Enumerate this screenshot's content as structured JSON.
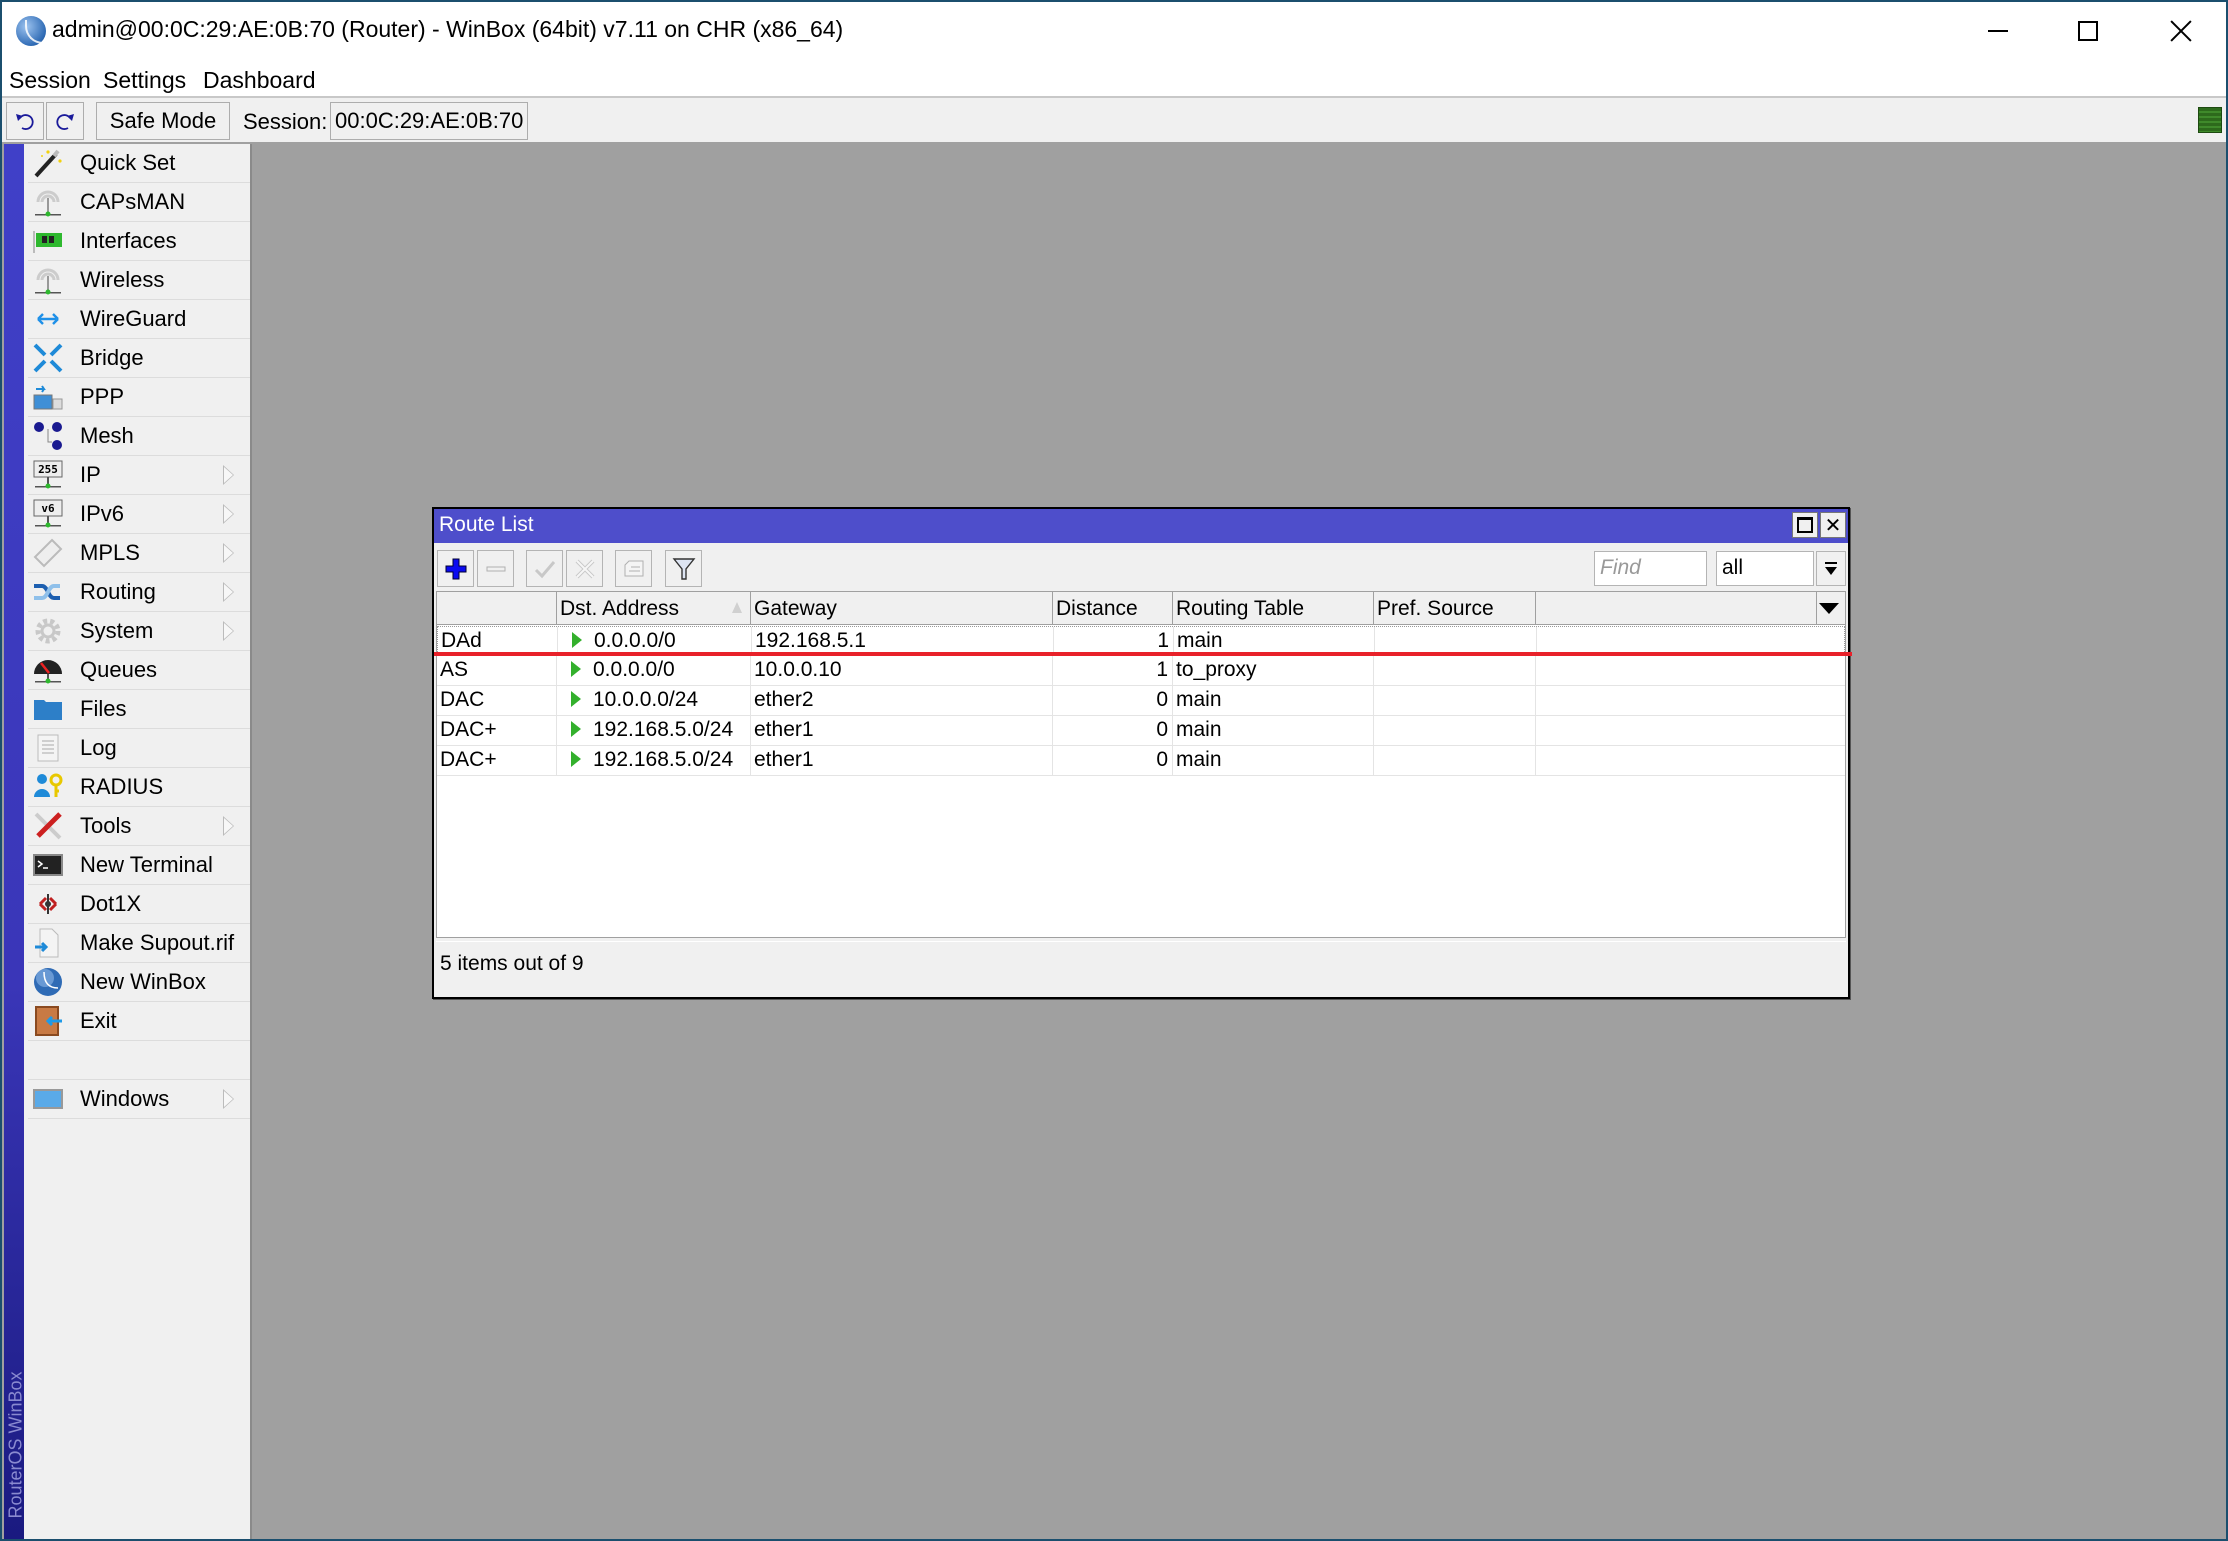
{
  "window": {
    "title": "admin@00:0C:29:AE:0B:70 (Router) - WinBox (64bit) v7.11 on CHR (x86_64)",
    "controls": {
      "minimize": "minimize",
      "maximize": "maximize",
      "close": "close"
    }
  },
  "menubar": [
    "Session",
    "Settings",
    "Dashboard"
  ],
  "toolbar": {
    "undo_icon": "undo-icon",
    "redo_icon": "redo-icon",
    "safe_mode_label": "Safe Mode",
    "session_label": "Session:",
    "session_value": "00:0C:29:AE:0B:70",
    "status_color": "#2d6a1c"
  },
  "sidebar": {
    "brand_vertical": "RouterOS WinBox",
    "accent_color": "#3a36b8",
    "items": [
      {
        "label": "Quick Set",
        "icon": "magic-wand-icon",
        "submenu": false
      },
      {
        "label": "CAPsMAN",
        "icon": "antenna-icon",
        "submenu": false
      },
      {
        "label": "Interfaces",
        "icon": "network-card-icon",
        "submenu": false
      },
      {
        "label": "Wireless",
        "icon": "antenna-icon",
        "submenu": false
      },
      {
        "label": "WireGuard",
        "icon": "wireguard-icon",
        "submenu": false
      },
      {
        "label": "Bridge",
        "icon": "bridge-arrows-icon",
        "submenu": false
      },
      {
        "label": "PPP",
        "icon": "ppp-icon",
        "submenu": false
      },
      {
        "label": "Mesh",
        "icon": "mesh-icon",
        "submenu": false
      },
      {
        "label": "IP",
        "icon": "ip-255-icon",
        "submenu": true
      },
      {
        "label": "IPv6",
        "icon": "ipv6-icon",
        "submenu": true
      },
      {
        "label": "MPLS",
        "icon": "tag-icon",
        "submenu": true
      },
      {
        "label": "Routing",
        "icon": "routing-arrows-icon",
        "submenu": true
      },
      {
        "label": "System",
        "icon": "gear-icon",
        "submenu": true
      },
      {
        "label": "Queues",
        "icon": "gauge-icon",
        "submenu": false
      },
      {
        "label": "Files",
        "icon": "folder-icon",
        "submenu": false
      },
      {
        "label": "Log",
        "icon": "log-icon",
        "submenu": false
      },
      {
        "label": "RADIUS",
        "icon": "user-key-icon",
        "submenu": false
      },
      {
        "label": "Tools",
        "icon": "tools-icon",
        "submenu": true
      },
      {
        "label": "New Terminal",
        "icon": "terminal-icon",
        "submenu": false
      },
      {
        "label": "Dot1X",
        "icon": "dot1x-icon",
        "submenu": false
      },
      {
        "label": "Make Supout.rif",
        "icon": "file-export-icon",
        "submenu": false
      },
      {
        "label": "New WinBox",
        "icon": "winbox-logo-icon",
        "submenu": false
      },
      {
        "label": "Exit",
        "icon": "exit-door-icon",
        "submenu": false
      },
      {
        "label": "",
        "icon": "",
        "submenu": false,
        "spacer": true
      },
      {
        "label": "Windows",
        "icon": "window-icon",
        "submenu": true
      }
    ]
  },
  "route_list": {
    "title": "Route List",
    "title_color": "#4e4ecb",
    "tools": [
      "add-icon",
      "remove-icon",
      "enable-check-icon",
      "disable-x-icon",
      "comment-icon",
      "filter-icon"
    ],
    "find_placeholder": "Find",
    "filter_value": "all",
    "columns": [
      "",
      "Dst. Address",
      "Gateway",
      "Distance",
      "Routing Table",
      "Pref. Source",
      ""
    ],
    "sorted_column": "Dst. Address",
    "rows": [
      {
        "flags": "DAd",
        "dst": "0.0.0.0/0",
        "gateway": "192.168.5.1",
        "distance": "1",
        "table": "main",
        "pref_source": ""
      },
      {
        "flags": "AS",
        "dst": "0.0.0.0/0",
        "gateway": "10.0.0.10",
        "distance": "1",
        "table": "to_proxy",
        "pref_source": ""
      },
      {
        "flags": "DAC",
        "dst": "10.0.0.0/24",
        "gateway": "ether2",
        "distance": "0",
        "table": "main",
        "pref_source": ""
      },
      {
        "flags": "DAC+",
        "dst": "192.168.5.0/24",
        "gateway": "ether1",
        "distance": "0",
        "table": "main",
        "pref_source": ""
      },
      {
        "flags": "DAC+",
        "dst": "192.168.5.0/24",
        "gateway": "ether1",
        "distance": "0",
        "table": "main",
        "pref_source": ""
      }
    ],
    "annotation_color": "#e8212a",
    "status": "5 items out of 9"
  }
}
